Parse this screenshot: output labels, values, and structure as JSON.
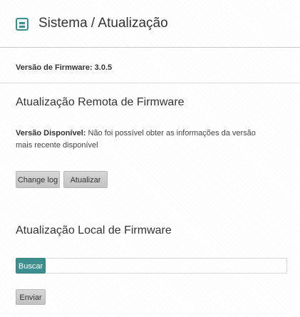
{
  "header": {
    "title": "Sistema / Atualização",
    "icon": "list-icon",
    "accent_color": "#3d8f8f"
  },
  "firmware": {
    "version_text": "Versão de Firmware: 3.0.5"
  },
  "remote": {
    "title": "Atualização Remota de Firmware",
    "available_label": "Versão Disponível:",
    "available_message": "Não foi possível obter as informações da versão mais recente disponível",
    "changelog_label": "Change log",
    "update_label": "Atualizar"
  },
  "local": {
    "title": "Atualização Local de Firmware",
    "browse_label": "Buscar",
    "file_value": "",
    "send_label": "Enviar"
  }
}
